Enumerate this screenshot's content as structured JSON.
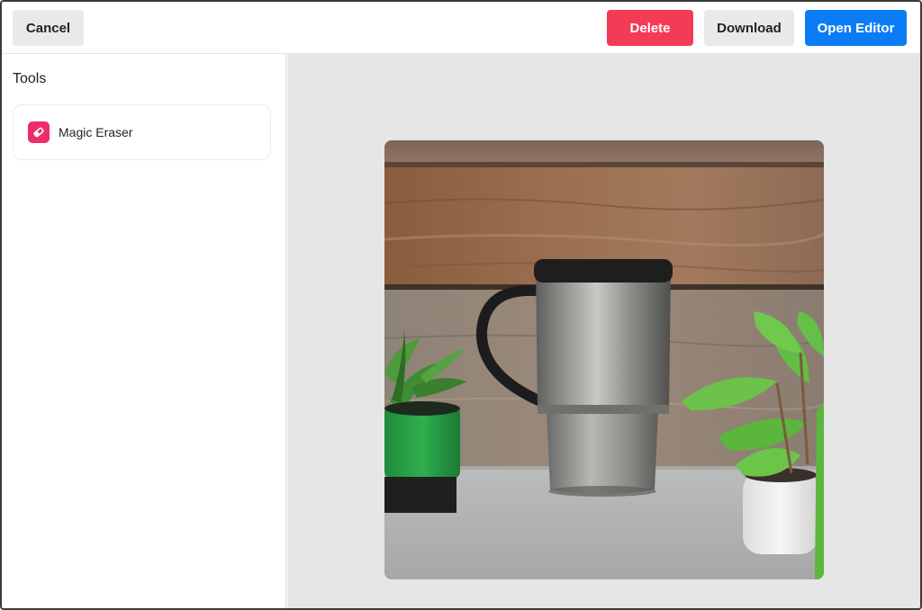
{
  "toolbar": {
    "cancel_label": "Cancel",
    "delete_label": "Delete",
    "download_label": "Download",
    "open_editor_label": "Open Editor"
  },
  "sidebar": {
    "heading": "Tools",
    "tools": [
      {
        "label": "Magic Eraser",
        "icon": "eraser-icon"
      }
    ]
  },
  "colors": {
    "delete": "#f43b55",
    "primary": "#0b7cf5",
    "secondary": "#e9e9e9",
    "tool_icon": "#ee2c6a",
    "canvas_bg": "#e6e6e6"
  }
}
